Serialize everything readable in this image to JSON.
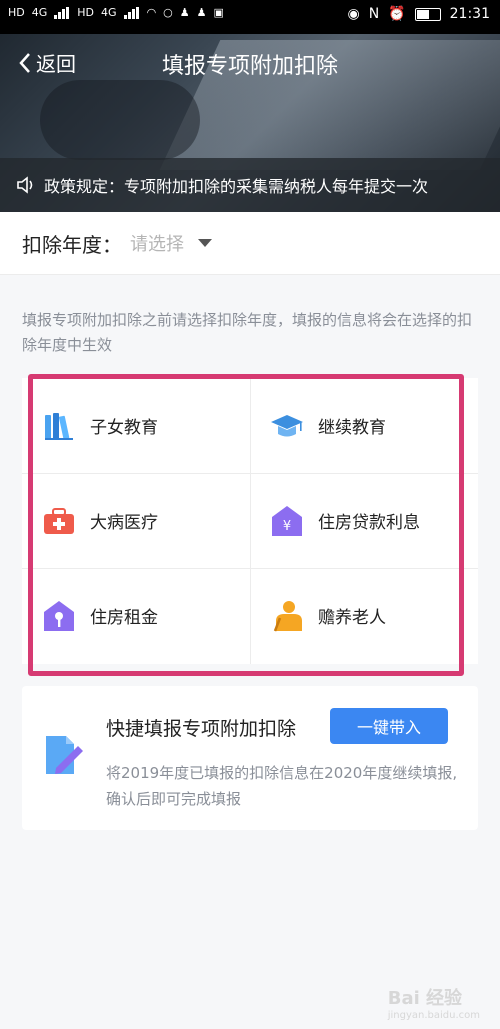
{
  "status_bar": {
    "left_indicators": [
      "HD",
      "4G",
      "HD",
      "4G"
    ],
    "time": "21:31"
  },
  "header": {
    "back_label": "返回",
    "title": "填报专项附加扣除"
  },
  "policy_banner": {
    "text": "政策规定：专项附加扣除的采集需纳税人每年提交一次"
  },
  "year_selector": {
    "label": "扣除年度：",
    "placeholder": "请选择"
  },
  "hint": "填报专项附加扣除之前请选择扣除年度，填报的信息将会在选择的扣除年度中生效",
  "deduction_items": [
    {
      "label": "子女教育",
      "icon": "books-icon",
      "color": "#4aa3f0"
    },
    {
      "label": "继续教育",
      "icon": "graduation-cap-icon",
      "color": "#3c8fdf"
    },
    {
      "label": "大病医疗",
      "icon": "medical-kit-icon",
      "color": "#ef5b4b"
    },
    {
      "label": "住房贷款利息",
      "icon": "house-yuan-icon",
      "color": "#8c6df0"
    },
    {
      "label": "住房租金",
      "icon": "house-key-icon",
      "color": "#8c6df0"
    },
    {
      "label": "赡养老人",
      "icon": "elderly-person-icon",
      "color": "#f5a623"
    }
  ],
  "quick_fill": {
    "title": "快捷填报专项附加扣除",
    "button_label": "一键带入",
    "description": "将2019年度已填报的扣除信息在2020年度继续填报,确认后即可完成填报",
    "icon": "edit-document-icon"
  },
  "colors": {
    "accent": "#3b87f2",
    "highlight_border": "#d63a72"
  },
  "watermark": {
    "text": "Bai 经验",
    "sub": "jingyan.baidu.com"
  }
}
